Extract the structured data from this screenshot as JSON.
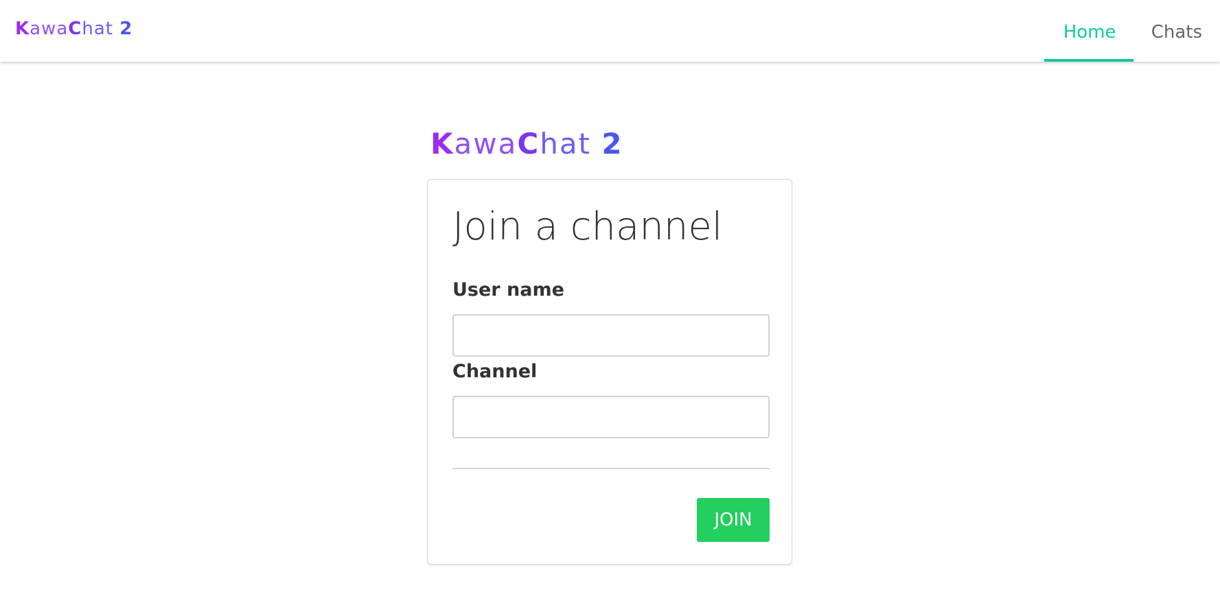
{
  "brand": {
    "k": "K",
    "awa": "awa",
    "c": "C",
    "hat": "hat",
    "two": "2"
  },
  "nav": {
    "tabs": [
      {
        "label": "Home",
        "active": true
      },
      {
        "label": "Chats",
        "active": false
      }
    ]
  },
  "form": {
    "title": "Join a channel",
    "username_label": "User name",
    "username_value": "",
    "channel_label": "Channel",
    "channel_value": "",
    "join_label": "JOIN"
  },
  "colors": {
    "accent": "#10c9a6",
    "join_button": "#22cf5f",
    "logo_purple": "#9a2df0",
    "logo_blue": "#4a57ec"
  }
}
